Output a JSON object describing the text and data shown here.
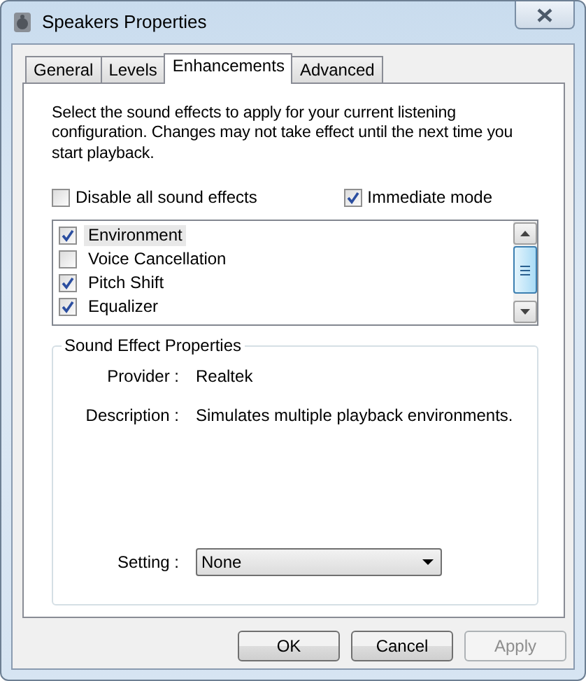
{
  "window": {
    "title": "Speakers Properties"
  },
  "tabs": [
    {
      "label": "General",
      "selected": false
    },
    {
      "label": "Levels",
      "selected": false
    },
    {
      "label": "Enhancements",
      "selected": true
    },
    {
      "label": "Advanced",
      "selected": false
    }
  ],
  "intro": "Select the sound effects to apply for your current listening configuration. Changes may not take effect until the next time you start playback.",
  "options": [
    {
      "label": "Disable all sound effects",
      "checked": false
    },
    {
      "label": "Immediate mode",
      "checked": true
    }
  ],
  "effects": [
    {
      "label": "Environment",
      "checked": true,
      "selected": true
    },
    {
      "label": "Voice Cancellation",
      "checked": false,
      "selected": false
    },
    {
      "label": "Pitch Shift",
      "checked": true,
      "selected": false
    },
    {
      "label": "Equalizer",
      "checked": true,
      "selected": false
    }
  ],
  "properties": {
    "title": "Sound Effect Properties",
    "provider_label": "Provider :",
    "provider": "Realtek",
    "description_label": "Description :",
    "description": "Simulates multiple playback environments.",
    "setting_label": "Setting :",
    "setting": "None"
  },
  "buttons": [
    {
      "label": "OK",
      "disabled": false
    },
    {
      "label": "Cancel",
      "disabled": false
    },
    {
      "label": "Apply",
      "disabled": true
    }
  ]
}
